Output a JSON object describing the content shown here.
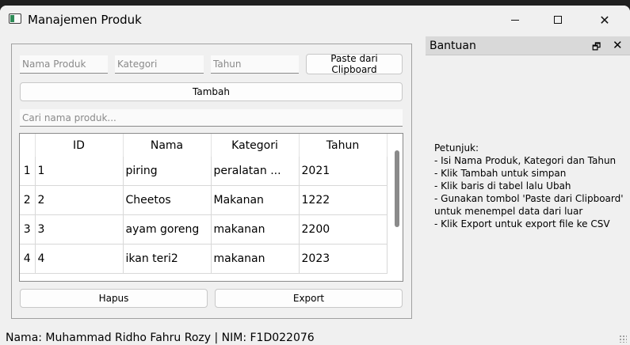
{
  "window": {
    "title": "Manajemen Produk",
    "icons": {
      "app": "app-window-icon",
      "minimize": "minimize-icon",
      "maximize": "maximize-icon",
      "close": "close-icon"
    }
  },
  "form": {
    "nama_placeholder": "Nama Produk",
    "kategori_placeholder": "Kategori",
    "tahun_placeholder": "Tahun",
    "paste_label": "Paste dari Clipboard",
    "tambah_label": "Tambah",
    "search_placeholder": "Cari nama produk..."
  },
  "table": {
    "columns": [
      "ID",
      "Nama",
      "Kategori",
      "Tahun"
    ],
    "rows": [
      {
        "num": "1",
        "id": "1",
        "nama": "piring",
        "kategori": "peralatan ...",
        "tahun": "2021"
      },
      {
        "num": "2",
        "id": "2",
        "nama": "Cheetos",
        "kategori": "Makanan",
        "tahun": "1222"
      },
      {
        "num": "3",
        "id": "3",
        "nama": "ayam goreng",
        "kategori": "makanan",
        "tahun": "2200"
      },
      {
        "num": "4",
        "id": "4",
        "nama": "ikan teri2",
        "kategori": "makanan",
        "tahun": "2023"
      }
    ]
  },
  "actions": {
    "hapus_label": "Hapus",
    "export_label": "Export"
  },
  "dock": {
    "title": "Bantuan",
    "float_icon": "float-icon",
    "close_icon": "close-icon",
    "help": "Petunjuk:\n- Isi Nama Produk, Kategori dan Tahun\n- Klik Tambah untuk simpan\n- Klik baris di tabel lalu Ubah\n- Gunakan tombol 'Paste dari Clipboard' untuk menempel data dari luar\n- Klik Export untuk export file ke CSV"
  },
  "status_bar": {
    "text": "Nama: Muhammad Ridho Fahru Rozy | NIM: F1D022076"
  }
}
